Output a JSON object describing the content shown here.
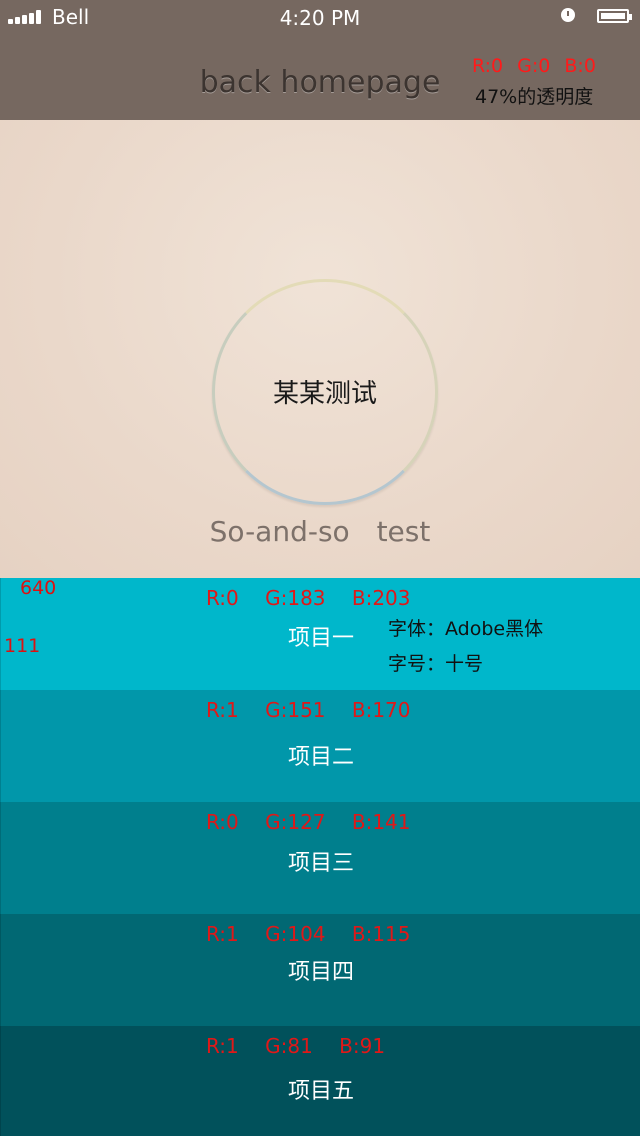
{
  "status_bar": {
    "carrier": "Bell",
    "time": "4:20 PM"
  },
  "nav": {
    "title": "back  homepage",
    "rgb": "R:0 G:0 B:0",
    "opacity": "47%的透明度",
    "color": "#766860"
  },
  "hero": {
    "ring_label": "某某测试",
    "subtitle": "So-and-so test"
  },
  "list": {
    "width_dim": "640",
    "height_dim": "111",
    "font_name": "字体：Adobe黑体",
    "font_size": "字号：十号",
    "items": [
      {
        "label": "项目一",
        "rgb": "R:0 G:183 B:203",
        "color": "#00b7cb"
      },
      {
        "label": "项目二",
        "rgb": "R:1 G:151 B:170",
        "color": "#0197aa"
      },
      {
        "label": "项目三",
        "rgb": "R:0 G:127 B:141",
        "color": "#007f8d"
      },
      {
        "label": "项目四",
        "rgb": "R:1 G:104 B:115",
        "color": "#016873"
      },
      {
        "label": "项目五",
        "rgb": "R:1 G:81 B:91",
        "color": "#01515b"
      }
    ]
  }
}
